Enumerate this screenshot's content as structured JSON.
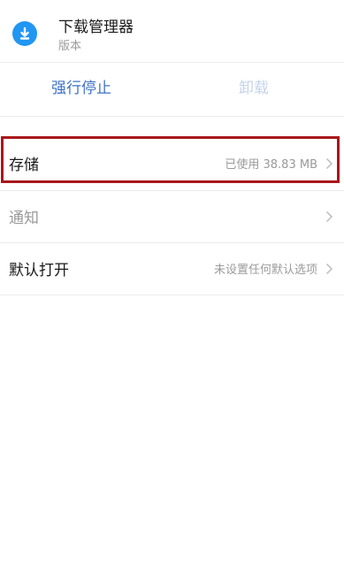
{
  "app": {
    "name": "下载管理器",
    "version_label": "版本",
    "icon": "download-icon"
  },
  "actions": {
    "force_stop": "强行停止",
    "uninstall": "卸载"
  },
  "settings": [
    {
      "label": "存储",
      "value": "已使用 38.83 MB",
      "label_color": "#1a1a1a",
      "highlighted": true
    },
    {
      "label": "通知",
      "value": "",
      "label_color": "#9a9a9a",
      "highlighted": false
    },
    {
      "label": "默认打开",
      "value": "未设置任何默认选项",
      "label_color": "#1a1a1a",
      "highlighted": false
    }
  ],
  "colors": {
    "accent": "#3f72c6",
    "disabled_accent": "#c5d3ea",
    "highlight_border": "#a8171b",
    "icon_blue": "#2196f3"
  }
}
